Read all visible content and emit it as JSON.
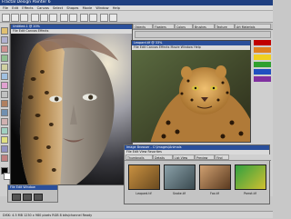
{
  "app": {
    "title": "Fractal Design Painter 6"
  },
  "menu": [
    "File",
    "Edit",
    "Effects",
    "Canvas",
    "Select",
    "Shapes",
    "Movie",
    "Window",
    "Help"
  ],
  "main_window": {
    "title": "Untitled-1 @ 20%",
    "menu": "File  Edit  Canvas  Effects"
  },
  "right_tabs": [
    "Objects",
    "Floaters",
    "Colors",
    "Brushes",
    "Texture",
    "Art Materials"
  ],
  "image_window": {
    "title": "Leopard.tif @ 33%",
    "menu": "File  Edit  Canvas  Effects  Movie  Window  Help"
  },
  "browser": {
    "title": "Image Browser - C:\\Images\\Animals",
    "tabs": [
      "Thumbnails",
      "Details",
      "List View",
      "Preview",
      "Find"
    ],
    "menu": "File  Edit  View  Favorites",
    "items": [
      "Leopard.tif",
      "Snake.tif",
      "Fox.tif",
      "Parrot.tif"
    ]
  },
  "bottom_window": {
    "title": "File  Edit  Window"
  },
  "status": "DISK: 4.5 MB  1230 x 980 pixels  RGB  8 bits/channel   Ready",
  "colors": {
    "title_blue": "#1f3f80",
    "swatches": [
      "#c00000",
      "#e08020",
      "#f0d020",
      "#30a030",
      "#2050c0",
      "#8030a0"
    ]
  }
}
